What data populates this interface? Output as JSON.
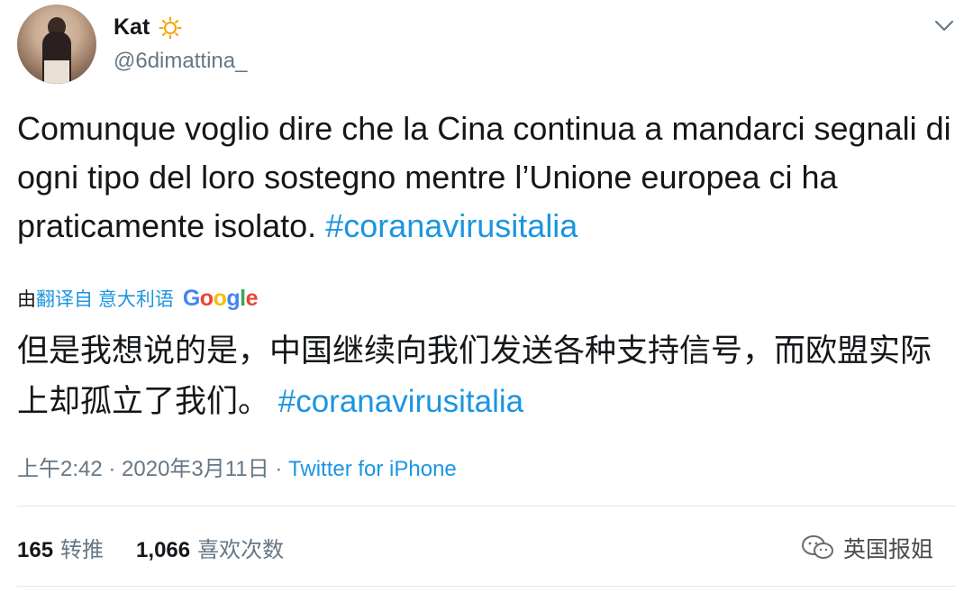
{
  "user": {
    "display_name": "Kat",
    "handle": "@6dimattina_"
  },
  "tweet": {
    "text": "Comunque voglio dire che la Cina continua a mandarci segnali di ogni tipo del loro sostegno mentre l’Unione europea ci ha praticamente isolato. ",
    "hashtag": "#coranavirusitalia"
  },
  "translation": {
    "prefix": "由",
    "link_label": "翻译自 意大利语",
    "provider_letters": [
      "G",
      "o",
      "o",
      "g",
      "l",
      "e"
    ],
    "text": "但是我想说的是，中国继续向我们发送各种支持信号，而欧盟实际上却孤立了我们。 ",
    "hashtag": "#coranavirusitalia"
  },
  "meta": {
    "time": "上午2:42 · 2020年3月11日 · ",
    "source": "Twitter for iPhone"
  },
  "stats": {
    "retweets_count": "165",
    "retweets_label": "转推",
    "likes_count": "1,066",
    "likes_label": "喜欢次数"
  },
  "watermark": {
    "text": "英国报姐"
  },
  "icons": {
    "name_emoji": "sun-icon",
    "menu": "chevron-down-icon",
    "watermark": "wechat-icon"
  },
  "colors": {
    "link": "#1b95e0",
    "secondary_text": "#657786",
    "primary_text": "#14171a",
    "divider": "#e1e8ed"
  }
}
